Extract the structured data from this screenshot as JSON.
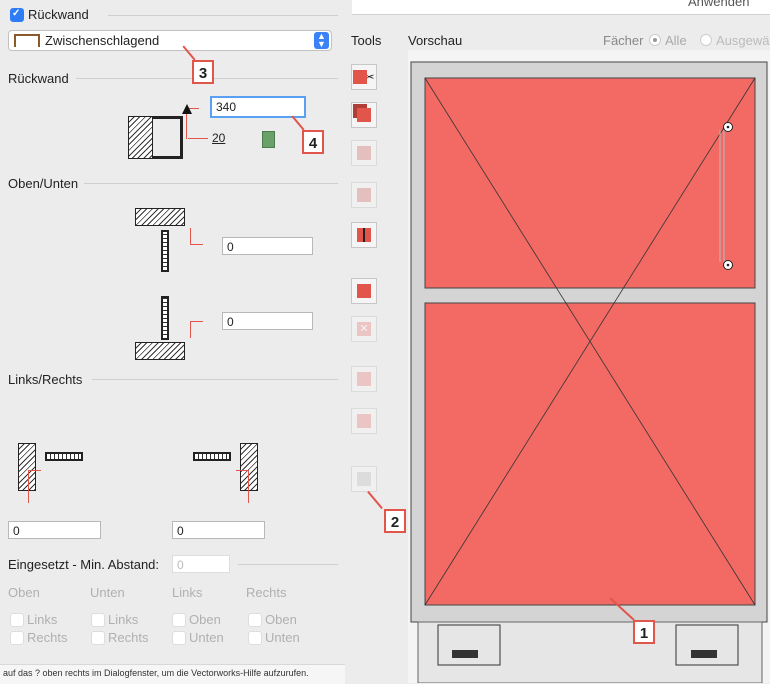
{
  "top": {
    "rueckwand_checkbox_label": "Rückwand",
    "apply_button": "Anwenden",
    "dropdown_value": "Zwischenschlagend",
    "tools_label": "Tools",
    "vorschau_label": "Vorschau",
    "faecher_label": "Fächer",
    "radio_alle": "Alle",
    "radio_ausgewaehlt": "Ausgewä"
  },
  "sections": {
    "rueckwand": "Rückwand",
    "rueckwand_value": "340",
    "rueckwand_thickness": "20",
    "oben_unten": "Oben/Unten",
    "oben_value": "0",
    "unten_value": "0",
    "links_rechts": "Links/Rechts",
    "links_value": "0",
    "rechts_value": "0",
    "eingesetzt_label": "Eingesetzt - Min. Abstand:",
    "eingesetzt_value": "0"
  },
  "grid": {
    "col_oben": "Oben",
    "col_unten": "Unten",
    "col_links": "Links",
    "col_rechts": "Rechts",
    "oben_opt1": "Links",
    "oben_opt2": "Rechts",
    "unten_opt1": "Links",
    "unten_opt2": "Rechts",
    "links_opt1": "Oben",
    "links_opt2": "Unten",
    "rechts_opt1": "Oben",
    "rechts_opt2": "Unten"
  },
  "help_text": "auf das ? oben rechts im Dialogfenster, um die Vectorworks-Hilfe aufzurufen.",
  "callouts": {
    "c1": "1",
    "c2": "2",
    "c3": "3",
    "c4": "4"
  },
  "colors": {
    "accent_red": "#e2554b",
    "panel_fill": "#f26a63",
    "focus_blue": "#5aa0f0"
  }
}
